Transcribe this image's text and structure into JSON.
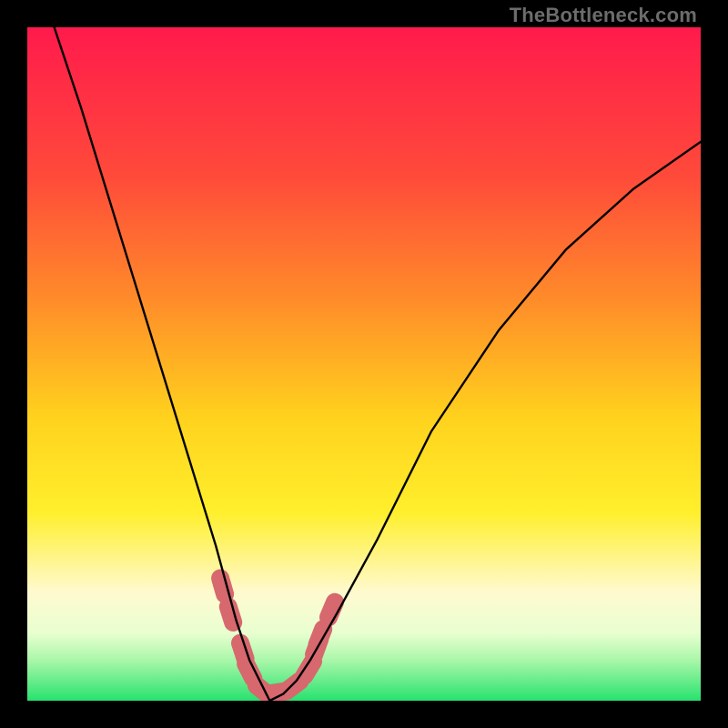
{
  "watermark": "TheBottleneck.com",
  "colors": {
    "frame": "#000000",
    "curve": "#000000",
    "segments": "#d6686e",
    "gradient_stops": [
      {
        "pct": 0,
        "color": "#ff1a4c"
      },
      {
        "pct": 22,
        "color": "#ff4a3a"
      },
      {
        "pct": 40,
        "color": "#ff8a2a"
      },
      {
        "pct": 58,
        "color": "#ffd21d"
      },
      {
        "pct": 72,
        "color": "#ffef2c"
      },
      {
        "pct": 80,
        "color": "#fff69a"
      },
      {
        "pct": 84,
        "color": "#fffad0"
      },
      {
        "pct": 90,
        "color": "#e8ffd0"
      },
      {
        "pct": 94,
        "color": "#a9f7a9"
      },
      {
        "pct": 100,
        "color": "#28e26f"
      }
    ]
  },
  "chart_data": {
    "type": "line",
    "title": "",
    "xlabel": "",
    "ylabel": "",
    "xlim": [
      0,
      1
    ],
    "ylim": [
      0,
      1
    ],
    "x_minimum": 0.36,
    "series": [
      {
        "name": "curve",
        "x": [
          0.04,
          0.08,
          0.12,
          0.16,
          0.2,
          0.24,
          0.28,
          0.31,
          0.33,
          0.35,
          0.36,
          0.38,
          0.4,
          0.42,
          0.46,
          0.52,
          0.6,
          0.7,
          0.8,
          0.9,
          1.0
        ],
        "y": [
          1.0,
          0.88,
          0.75,
          0.62,
          0.49,
          0.36,
          0.23,
          0.12,
          0.06,
          0.02,
          0.0,
          0.01,
          0.03,
          0.06,
          0.13,
          0.24,
          0.4,
          0.55,
          0.67,
          0.76,
          0.83
        ]
      }
    ],
    "highlight_segments": {
      "name": "near-minimum-markers",
      "points": [
        {
          "x": 0.29,
          "y": 0.17
        },
        {
          "x": 0.302,
          "y": 0.128
        },
        {
          "x": 0.32,
          "y": 0.074
        },
        {
          "x": 0.33,
          "y": 0.044
        },
        {
          "x": 0.35,
          "y": 0.015
        },
        {
          "x": 0.37,
          "y": 0.012
        },
        {
          "x": 0.395,
          "y": 0.022
        },
        {
          "x": 0.418,
          "y": 0.048
        },
        {
          "x": 0.43,
          "y": 0.08
        },
        {
          "x": 0.435,
          "y": 0.095
        },
        {
          "x": 0.452,
          "y": 0.135
        }
      ]
    }
  }
}
